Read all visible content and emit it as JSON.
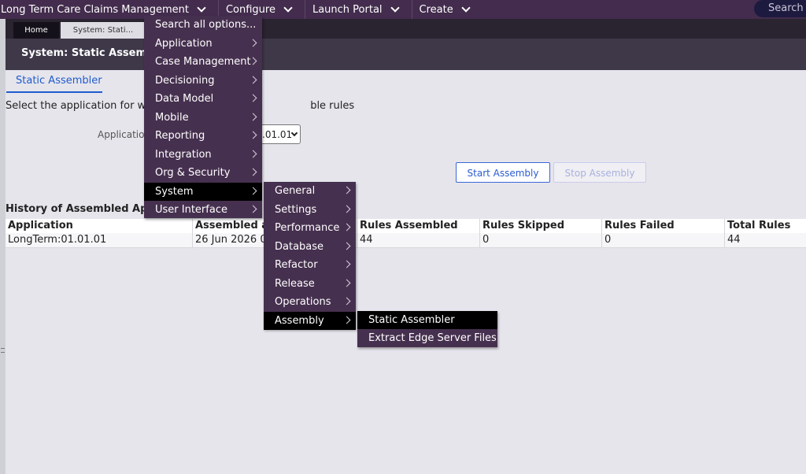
{
  "topbar": {
    "menus": [
      {
        "label": "Long Term Care Claims Management"
      },
      {
        "label": "Configure"
      },
      {
        "label": "Launch Portal"
      },
      {
        "label": "Create"
      }
    ],
    "search_label": "Search"
  },
  "tabs": [
    {
      "label": "Home"
    },
    {
      "label": "System: Stati..."
    }
  ],
  "header": {
    "title": "System: Static Assembler"
  },
  "subtab": {
    "label": "Static Assembler"
  },
  "form": {
    "instruction": "Select the application for which you want to assemble rules",
    "instruction_visible_start": "Select the application for whic",
    "instruction_visible_end": "ble rules",
    "application_label": "Application",
    "application_value": ".01.01"
  },
  "buttons": {
    "start": "Start Assembly",
    "stop": "Stop Assembly"
  },
  "history": {
    "title": "History of Assembled Applic",
    "columns": [
      "Application",
      "Assembled at",
      "",
      "Rules Assembled",
      "Rules Skipped",
      "Rules Failed",
      "Total Rules"
    ],
    "rows": [
      [
        "LongTerm:01.01.01",
        "26 Jun 2026 02",
        "",
        "44",
        "0",
        "0",
        "44"
      ]
    ]
  },
  "configure_menu": {
    "items": [
      {
        "label": "Search all options..."
      },
      {
        "label": "Application"
      },
      {
        "label": "Case Management"
      },
      {
        "label": "Decisioning"
      },
      {
        "label": "Data Model"
      },
      {
        "label": "Mobile"
      },
      {
        "label": "Reporting"
      },
      {
        "label": "Integration"
      },
      {
        "label": "Org & Security"
      },
      {
        "label": "System"
      },
      {
        "label": "User Interface"
      }
    ]
  },
  "system_menu": {
    "items": [
      {
        "label": "General"
      },
      {
        "label": "Settings"
      },
      {
        "label": "Performance"
      },
      {
        "label": "Database"
      },
      {
        "label": "Refactor"
      },
      {
        "label": "Release"
      },
      {
        "label": "Operations"
      },
      {
        "label": "Assembly"
      }
    ]
  },
  "assembly_menu": {
    "items": [
      {
        "label": "Static Assembler"
      },
      {
        "label": "Extract Edge Server Files"
      }
    ]
  },
  "colors": {
    "topbar": "#432c4d",
    "menu_bg": "#46304f",
    "menu_selected": "#000000",
    "accent_blue": "#1f5ccc"
  }
}
